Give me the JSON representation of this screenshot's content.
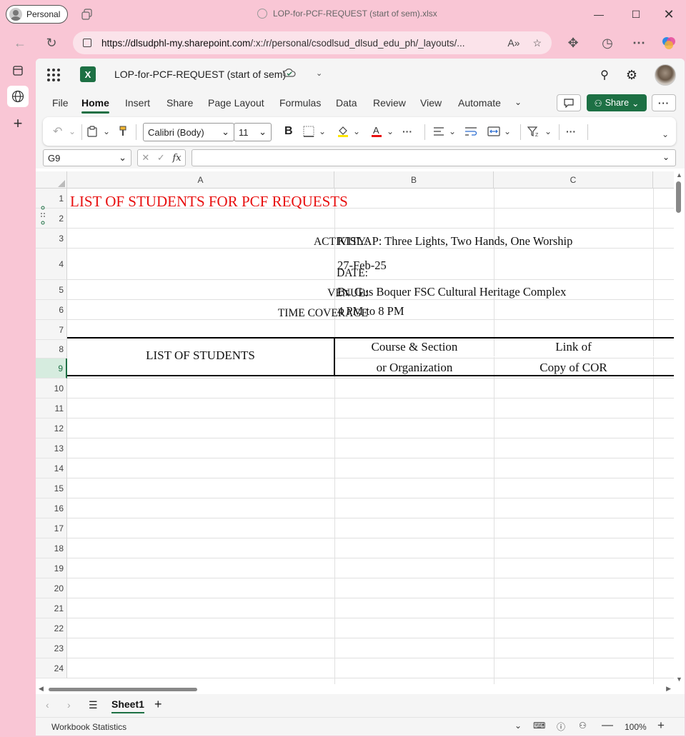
{
  "browser": {
    "profile_label": "Personal",
    "window_title": "LOP-for-PCF-REQUEST (start of sem).xlsx",
    "url_host": "https://dlsudphl-my.sharepoint.com",
    "url_path": "/:x:/r/personal/csodlsud_dlsud_edu_ph/_layouts/..."
  },
  "app": {
    "doc_title": "LOP-for-PCF-REQUEST (start of sem)",
    "menu": [
      "File",
      "Home",
      "Insert",
      "Share",
      "Page Layout",
      "Formulas",
      "Data",
      "Review",
      "View",
      "Automate"
    ],
    "active_menu": "Home",
    "share_label": "Share",
    "font_name": "Calibri (Body)",
    "font_size": "11",
    "name_box": "G9",
    "fx_label": "fx"
  },
  "sheet": {
    "columns": [
      "A",
      "B",
      "C"
    ],
    "rows": [
      "1",
      "2",
      "3",
      "4",
      "5",
      "6",
      "7",
      "8",
      "9",
      "10",
      "11",
      "12",
      "13",
      "14",
      "15",
      "16",
      "17",
      "18",
      "19",
      "20",
      "21",
      "22",
      "23",
      "24"
    ],
    "selected_row": "9",
    "title": "LIST OF STUDENTS FOR PCF REQUESTS",
    "activity_label": "ACTIVITY:",
    "activity_value": "KISLAP: Three Lights, Two Hands, One Worship",
    "date_label": "DATE:",
    "date_value": "27-Feb-25",
    "venue_label": "VENUE:",
    "venue_value": "Br. Gus Boquer FSC Cultural Heritage Complex",
    "time_label": "TIME COVERAGE",
    "time_value": "4 PM to 8 PM",
    "header_students": "LIST OF STUDENTS",
    "header_course_1": "Course & Section",
    "header_course_2": "or Organization",
    "header_link_1": "Link of",
    "header_link_2": "Copy of COR",
    "title_color": "#e81010"
  },
  "footer": {
    "sheet_tab": "Sheet1",
    "status_left": "Workbook Statistics",
    "zoom": "100%"
  }
}
